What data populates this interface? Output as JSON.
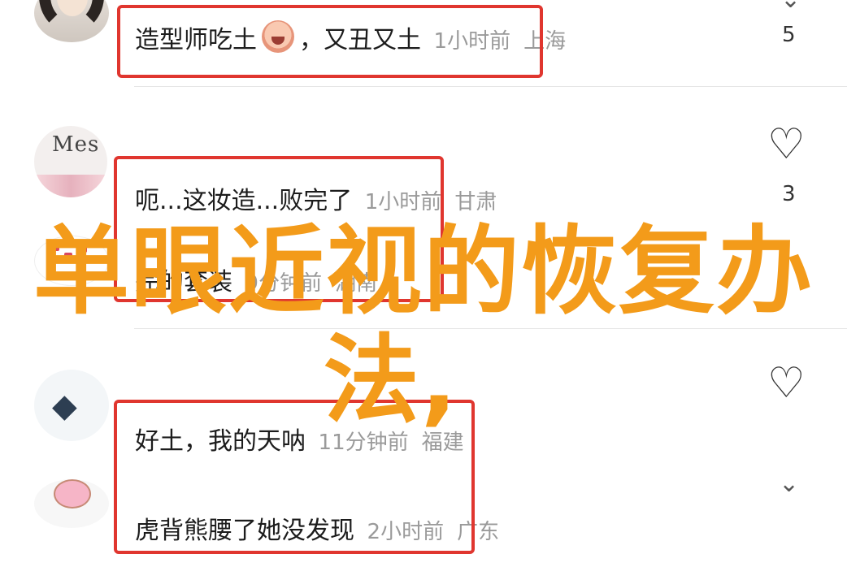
{
  "comments": [
    {
      "text": "造型师吃土",
      "text2": "，又丑又土",
      "time": "1小时前",
      "location": "上海",
      "likes": "5"
    },
    {
      "text": "呃...这妆造...败完了",
      "time": "1小时前",
      "location": "甘肃",
      "likes": "3",
      "line2": "完的套装",
      "time2": "9分钟前",
      "location2": "湖南"
    },
    {
      "text": "好土，我的天呐",
      "time": "11分钟前",
      "location": "福建"
    },
    {
      "text": "虎背熊腰了她没发现",
      "time": "2小时前",
      "location": "广东"
    }
  ],
  "avatar_text": "Mes",
  "overlay": {
    "line1": "单眼近视的恢复办",
    "line2": "法,"
  },
  "colors": {
    "accent_red": "#e0362f",
    "overlay_orange": "#f39b1a"
  },
  "icons": {
    "like": "heart-outline-icon",
    "expand": "chevron-down-icon",
    "badge": "diamond-icon"
  }
}
